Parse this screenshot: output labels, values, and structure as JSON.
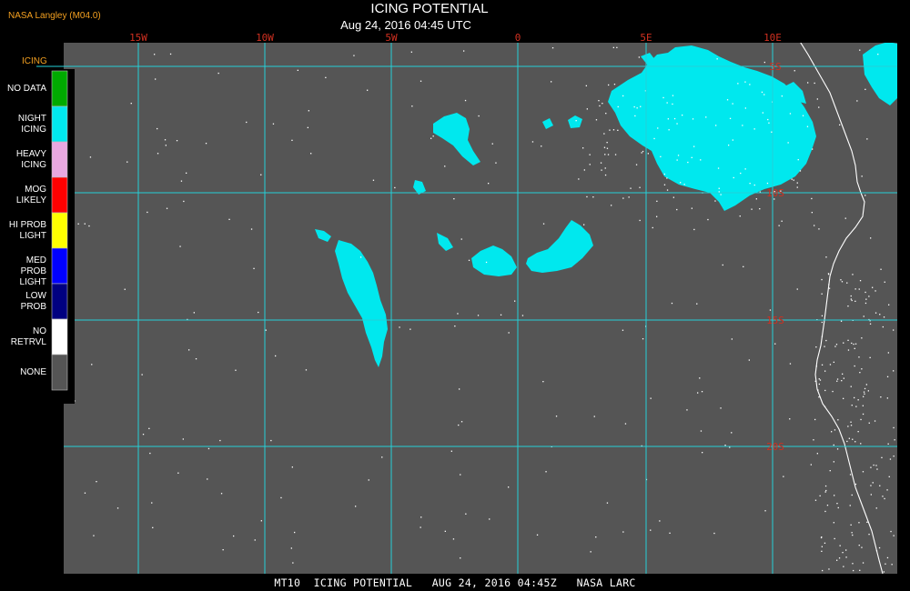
{
  "header": {
    "credit": "NASA Langley (M04.0)",
    "title": "ICING POTENTIAL",
    "subtitle": "Aug 24, 2016 04:45 UTC"
  },
  "footer": {
    "caption": "MT10  ICING POTENTIAL   AUG 24, 2016 04:45Z   NASA LARC"
  },
  "legend": {
    "heading": "ICING",
    "items": [
      {
        "label": "NO DATA",
        "color": "#00aa00"
      },
      {
        "label": "NIGHT\nICING",
        "color": "#00e8ee"
      },
      {
        "label": "HEAVY\nICING",
        "color": "#e8a8e0"
      },
      {
        "label": "MOG\nLIKELY",
        "color": "#ff0000"
      },
      {
        "label": "HI PROB\nLIGHT",
        "color": "#ffff00"
      },
      {
        "label": "MED PROB\nLIGHT",
        "color": "#0000ff"
      },
      {
        "label": "LOW\nPROB",
        "color": "#000080"
      },
      {
        "label": "NO\nRETRVL",
        "color": "#ffffff"
      },
      {
        "label": "NONE",
        "color": "#555555"
      }
    ]
  },
  "map": {
    "background_color": "#555555",
    "icing_color": "#00e8ee",
    "grid_color": "#25d0d8",
    "grid_label_color": "#d03020",
    "coast_color": "#ffffff",
    "longitude_labels": [
      "15W",
      "10W",
      "5W",
      "0",
      "5E",
      "10E"
    ],
    "latitude_labels": [
      "5S",
      "10S",
      "15S",
      "20S"
    ]
  }
}
